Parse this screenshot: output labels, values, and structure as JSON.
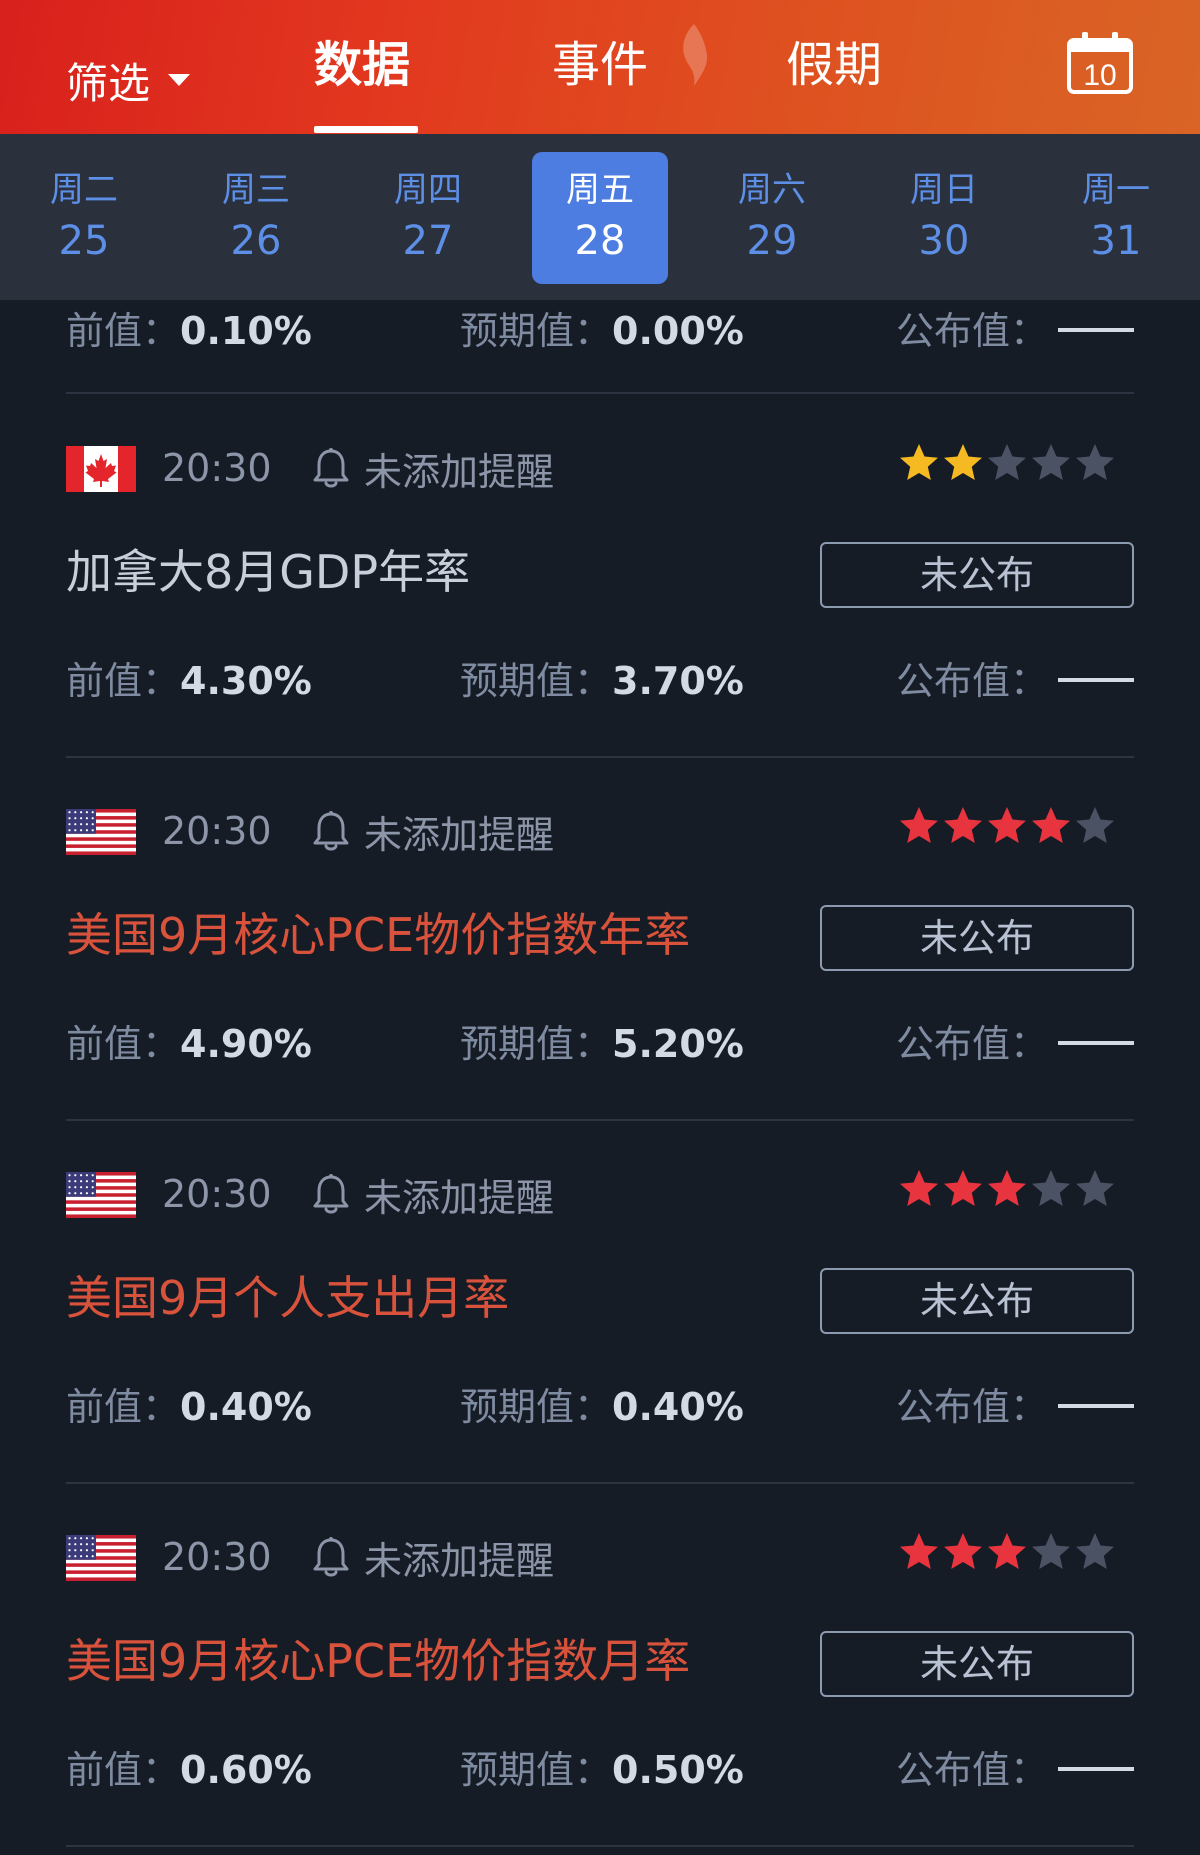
{
  "header": {
    "filter_label": "筛选",
    "tabs": [
      {
        "label": "数据",
        "active": true
      },
      {
        "label": "事件",
        "active": false
      },
      {
        "label": "假期",
        "active": false
      }
    ],
    "calendar_day": "10",
    "gradient_colors": [
      "#d8201c",
      "#d96426"
    ]
  },
  "days": [
    {
      "weekday": "周二",
      "date": "25",
      "active": false
    },
    {
      "weekday": "周三",
      "date": "26",
      "active": false
    },
    {
      "weekday": "周四",
      "date": "27",
      "active": false
    },
    {
      "weekday": "周五",
      "date": "28",
      "active": true
    },
    {
      "weekday": "周六",
      "date": "29",
      "active": false
    },
    {
      "weekday": "周日",
      "date": "30",
      "active": false
    },
    {
      "weekday": "周一",
      "date": "31",
      "active": false
    }
  ],
  "labels": {
    "prev": "前值",
    "expected": "预期值",
    "actual": "公布值",
    "colon": "："
  },
  "partial_item": {
    "prev_value": "0.10%",
    "expected_value": "0.00%"
  },
  "items": [
    {
      "flag": "canada-flag-icon",
      "time": "20:30",
      "reminder": "未添加提醒",
      "stars": 2,
      "star_color": "#f5b921",
      "title": "加拿大8月GDP年率",
      "title_highlight": false,
      "status": "未公布",
      "prev_value": "4.30%",
      "expected_value": "3.70%"
    },
    {
      "flag": "usa-flag-icon",
      "time": "20:30",
      "reminder": "未添加提醒",
      "stars": 4,
      "star_color": "#e8343e",
      "title": "美国9月核心PCE物价指数年率",
      "title_highlight": true,
      "status": "未公布",
      "prev_value": "4.90%",
      "expected_value": "5.20%"
    },
    {
      "flag": "usa-flag-icon",
      "time": "20:30",
      "reminder": "未添加提醒",
      "stars": 3,
      "star_color": "#e8343e",
      "title": "美国9月个人支出月率",
      "title_highlight": true,
      "status": "未公布",
      "prev_value": "0.40%",
      "expected_value": "0.40%"
    },
    {
      "flag": "usa-flag-icon",
      "time": "20:30",
      "reminder": "未添加提醒",
      "stars": 3,
      "star_color": "#e8343e",
      "title": "美国9月核心PCE物价指数月率",
      "title_highlight": true,
      "status": "未公布",
      "prev_value": "0.60%",
      "expected_value": "0.50%"
    }
  ],
  "colors": {
    "background": "#161c26",
    "day_strip": "#2a313d",
    "active_day": "#4d7de0",
    "highlight_title": "#d9533c",
    "inactive_star": "#4a5263"
  }
}
